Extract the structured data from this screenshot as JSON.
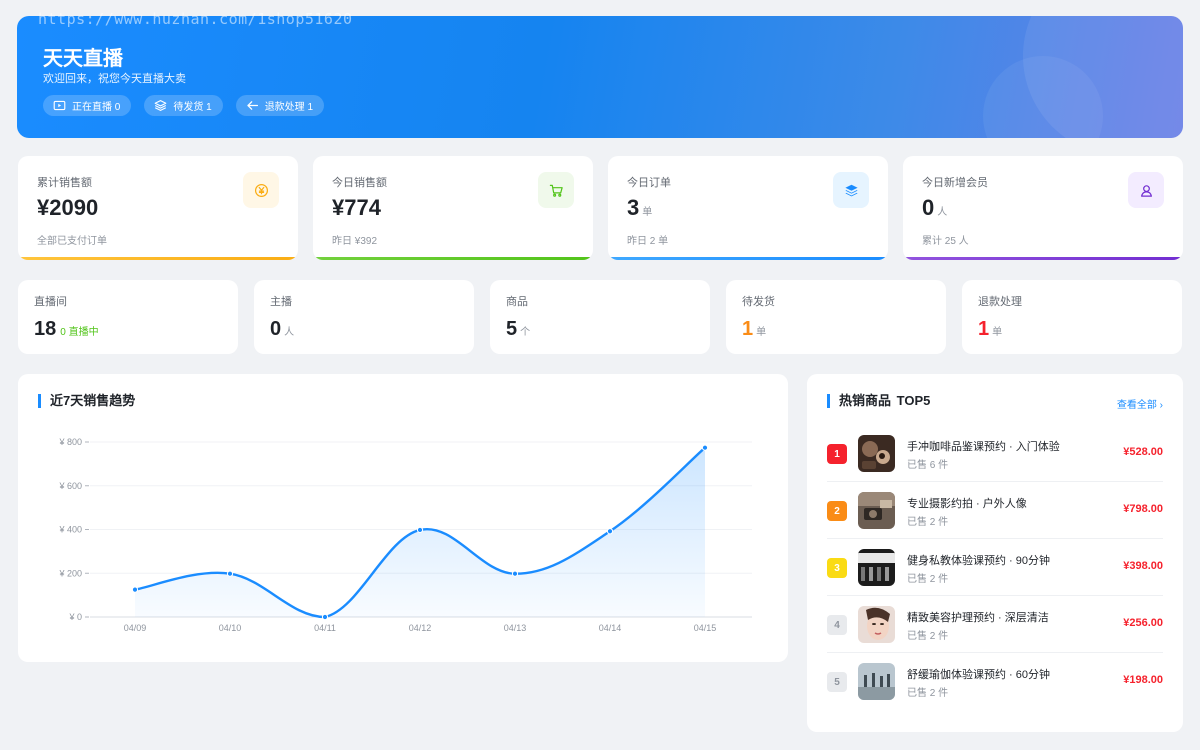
{
  "watermark": "https://www.huzhan.com/1shop51620",
  "hero": {
    "title": "天天直播",
    "subtitle": "欢迎回来，祝您今天直播大卖",
    "pills": [
      {
        "label": "正在直播 0",
        "icon": "video-icon"
      },
      {
        "label": "待发货 1",
        "icon": "layers-icon"
      },
      {
        "label": "退款处理 1",
        "icon": "arrow-left-icon"
      }
    ]
  },
  "stats": [
    {
      "label": "累计销售额",
      "value": "¥2090",
      "unit": "",
      "sub": "全部已支付订单",
      "icon": "yen-icon",
      "color": "#faad14"
    },
    {
      "label": "今日销售额",
      "value": "¥774",
      "unit": "",
      "sub": "昨日 ¥392",
      "icon": "cart-icon",
      "color": "#52c41a"
    },
    {
      "label": "今日订单",
      "value": "3",
      "unit": "单",
      "sub": "昨日 2 单",
      "icon": "layers-icon",
      "color": "#1a8cff"
    },
    {
      "label": "今日新增会员",
      "value": "0",
      "unit": "人",
      "sub": "累计 25 人",
      "icon": "user-icon",
      "color": "#722ed1"
    }
  ],
  "mini": [
    {
      "label": "直播间",
      "value": "18",
      "unit": "",
      "extra": "0 直播中",
      "color": "#1f2329"
    },
    {
      "label": "主播",
      "value": "0",
      "unit": "人",
      "extra": "",
      "color": "#1f2329"
    },
    {
      "label": "商品",
      "value": "5",
      "unit": "个",
      "extra": "",
      "color": "#1f2329"
    },
    {
      "label": "待发货",
      "value": "1",
      "unit": "单",
      "extra": "",
      "color": "#fa8c16"
    },
    {
      "label": "退款处理",
      "value": "1",
      "unit": "单",
      "extra": "",
      "color": "#f5222d"
    }
  ],
  "trend": {
    "title": "近7天销售趋势"
  },
  "chart_data": {
    "type": "area",
    "x": [
      "04/09",
      "04/10",
      "04/11",
      "04/12",
      "04/13",
      "04/14",
      "04/15"
    ],
    "values": [
      125,
      198,
      0,
      398,
      198,
      392,
      774
    ],
    "ylim": [
      0,
      800
    ],
    "yticks": [
      0,
      200,
      400,
      600,
      800
    ],
    "ytick_labels": [
      "¥ 0",
      "¥ 200",
      "¥ 400",
      "¥ 600",
      "¥ 800"
    ],
    "grid": true,
    "color": "#1a8cff"
  },
  "hot": {
    "title": "热销商品",
    "title_suffix": "TOP5",
    "view_all": "查看全部 ›",
    "items": [
      {
        "rank": "1",
        "name": "手冲咖啡品鉴课预约 · 入门体验",
        "sold": "已售 6 件",
        "price": "¥528.00",
        "badge_color": "#f5222d"
      },
      {
        "rank": "2",
        "name": "专业摄影约拍 · 户外人像",
        "sold": "已售 2 件",
        "price": "¥798.00",
        "badge_color": "#fa8c16"
      },
      {
        "rank": "3",
        "name": "健身私教体验课预约 · 90分钟",
        "sold": "已售 2 件",
        "price": "¥398.00",
        "badge_color": "#fadb14"
      },
      {
        "rank": "4",
        "name": "精致美容护理预约 · 深层清洁",
        "sold": "已售 2 件",
        "price": "¥256.00",
        "badge_color": "#e8eaed"
      },
      {
        "rank": "5",
        "name": "舒缓瑜伽体验课预约 · 60分钟",
        "sold": "已售 2 件",
        "price": "¥198.00",
        "badge_color": "#e8eaed"
      }
    ]
  }
}
